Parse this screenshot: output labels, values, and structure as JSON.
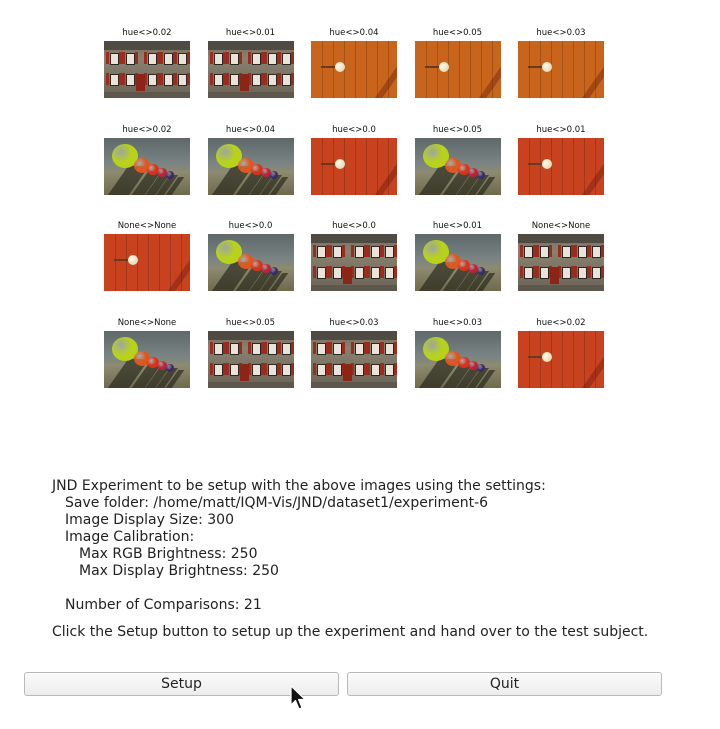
{
  "grid": [
    [
      {
        "label": "hue<>0.02",
        "image": "building"
      },
      {
        "label": "hue<>0.01",
        "image": "building"
      },
      {
        "label": "hue<>0.04",
        "image": "barn-orange"
      },
      {
        "label": "hue<>0.05",
        "image": "barn-orange"
      },
      {
        "label": "hue<>0.03",
        "image": "barn-orange"
      }
    ],
    [
      {
        "label": "hue<>0.02",
        "image": "hats"
      },
      {
        "label": "hue<>0.04",
        "image": "hats"
      },
      {
        "label": "hue<>0.0",
        "image": "barn"
      },
      {
        "label": "hue<>0.05",
        "image": "hats"
      },
      {
        "label": "hue<>0.01",
        "image": "barn"
      }
    ],
    [
      {
        "label": "None<>None",
        "image": "barn"
      },
      {
        "label": "hue<>0.0",
        "image": "hats"
      },
      {
        "label": "hue<>0.0",
        "image": "building"
      },
      {
        "label": "hue<>0.01",
        "image": "hats"
      },
      {
        "label": "None<>None",
        "image": "building"
      }
    ],
    [
      {
        "label": "None<>None",
        "image": "hats"
      },
      {
        "label": "hue<>0.05",
        "image": "building"
      },
      {
        "label": "hue<>0.03",
        "image": "building"
      },
      {
        "label": "hue<>0.03",
        "image": "hats"
      },
      {
        "label": "hue<>0.02",
        "image": "barn"
      }
    ]
  ],
  "message": {
    "intro": "JND Experiment to be setup with the above images using the settings:",
    "save_folder": "Save folder: /home/matt/IQM-Vis/JND/dataset1/experiment-6",
    "display_size": "Image Display Size: 300",
    "calibration": "Image Calibration:",
    "max_rgb": "Max RGB Brightness: 250",
    "max_display": "Max Display Brightness: 250",
    "comparisons": "Number of Comparisons: 21",
    "instructions": "Click the Setup button to setup up the experiment and hand over to the test subject."
  },
  "buttons": {
    "setup": "Setup",
    "quit": "Quit"
  }
}
